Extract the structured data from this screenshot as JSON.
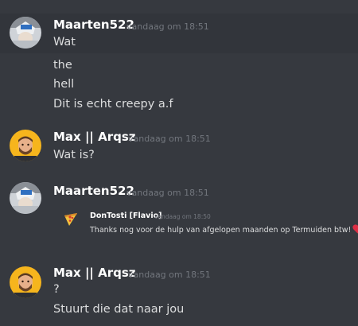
{
  "messages": [
    {
      "author": "Maarten522",
      "timestamp": "vandaag om 18:51",
      "lines": [
        "Wat",
        "the",
        "hell",
        "Dit is echt creepy a.f"
      ]
    },
    {
      "author": "Max || Arqsz",
      "timestamp": "vandaag om 18:51",
      "lines": [
        "Wat is?"
      ]
    },
    {
      "author": "Maarten522",
      "timestamp": "vandaag om 18:51",
      "embed": {
        "author": "DonTosti [Flavio]",
        "timestamp": "vandaag om 18:50",
        "text": "Thanks nog voor de hulp van afgelopen maanden op Termuiden btw!",
        "emoji": "red-heart-icon"
      }
    },
    {
      "author": "Max || Arqsz",
      "timestamp": "vandaag om 18:51",
      "lines": [
        "?",
        "Stuurt die dat naar jou"
      ]
    }
  ],
  "colors": {
    "background": "#36393f",
    "hover_background": "#32353b",
    "username": "#ffffff",
    "message_text": "#dcddde",
    "timestamp": "#72767d",
    "heart": "#dd2e44"
  }
}
